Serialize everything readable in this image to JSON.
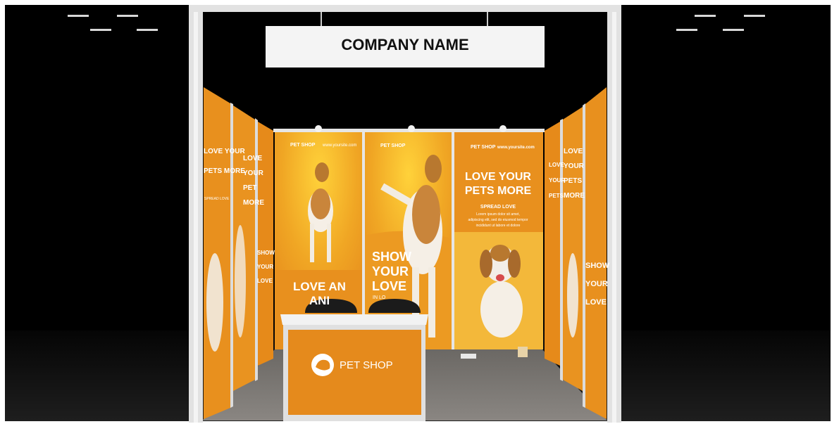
{
  "sign": {
    "company_name": "COMPANY NAME"
  },
  "panels": {
    "center_left": {
      "brand": "PET SHOP",
      "website": "www.yoursite.com",
      "headline_1": "LOVE AN",
      "headline_2": "ANI"
    },
    "center_middle": {
      "brand": "PET SHOP",
      "headline_1": "SHOW",
      "headline_2": "YOUR",
      "headline_3": "LOVE",
      "footer": "IN LO"
    },
    "center_right": {
      "brand": "PET SHOP",
      "website": "www.yoursite.com",
      "headline_1": "LOVE YOUR",
      "headline_2": "PETS MORE",
      "subheadline": "SPREAD LOVE",
      "body_1": "Lorem ipsum dolor sit amet,",
      "body_2": "adipiscing elit, sed do eiusmod tempor",
      "body_3": "incididunt ut labore et dolore"
    },
    "left_wall_front": {
      "headline_1": "LOVE YOUR",
      "headline_2": "PETS MORE",
      "subheadline": "SPREAD LOVE"
    },
    "left_wall_middle": {
      "headline": [
        "LOVE",
        "YOUR",
        "PET",
        "MORE"
      ]
    },
    "left_wall_back": {
      "headline": [
        "SHOW",
        "YOUR",
        "LOVE"
      ]
    },
    "right_wall_back": {
      "headline": [
        "LOVE",
        "YOUR",
        "PETS"
      ]
    },
    "right_wall_middle": {
      "headline": [
        "LOVE",
        "YOUR",
        "PETS",
        "MORE"
      ]
    },
    "right_wall_front": {
      "headline": [
        "SHOW",
        "YOUR",
        "LOVE"
      ]
    }
  },
  "counter": {
    "brand": "PET SHOP"
  },
  "colors": {
    "background": "#000000",
    "frame": "#e2e2e2",
    "panel_orange": "#e8901e",
    "panel_light": "#f4b42c",
    "counter_orange": "#e58a1c",
    "floor": "#7a7672",
    "sign_bg": "#f4f4f4"
  }
}
